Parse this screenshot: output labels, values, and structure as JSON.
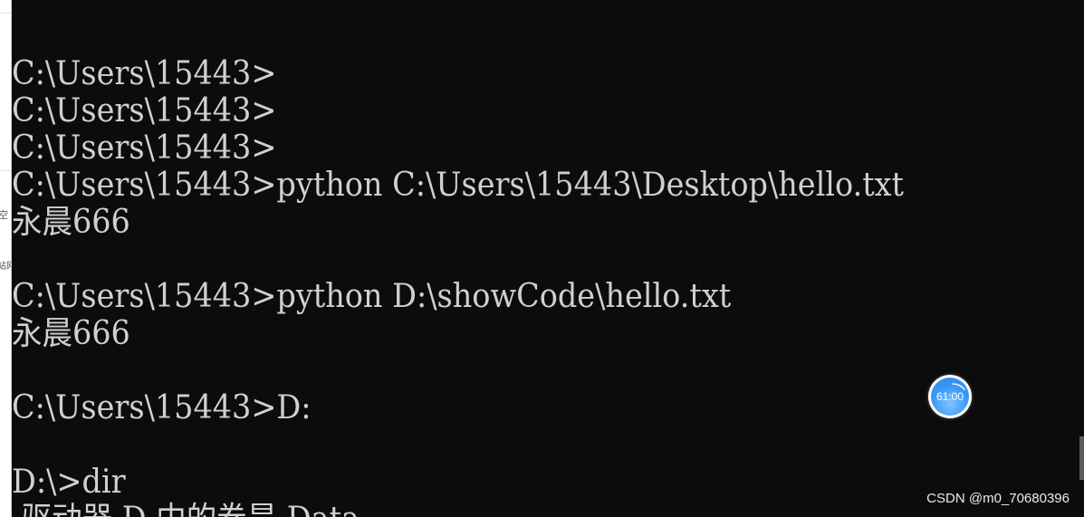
{
  "background_window": {
    "fragment_1": "空",
    "fragment_2": "站网"
  },
  "console": {
    "lines": [
      "C:\\Users\\15443>",
      "C:\\Users\\15443>",
      "C:\\Users\\15443>",
      "C:\\Users\\15443>python C:\\Users\\15443\\Desktop\\hello.txt",
      "永晨666",
      "",
      "C:\\Users\\15443>python D:\\showCode\\hello.txt",
      "永晨666",
      "",
      "C:\\Users\\15443>D:",
      "",
      "D:\\>dir",
      " 驱动器 D 中的卷是 Data"
    ]
  },
  "timer": {
    "value": "61:00",
    "icon": "timer-icon"
  },
  "watermark": "CSDN @m0_70680396",
  "colors": {
    "console_background": "#0c0c0c",
    "console_text": "#d0d0d0",
    "timer_blue": "#3a97f5"
  }
}
